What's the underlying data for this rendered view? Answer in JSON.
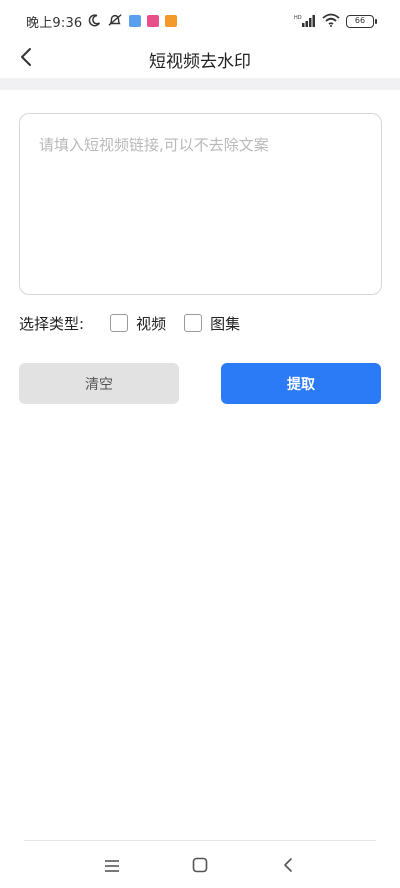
{
  "status_bar": {
    "time": "晚上9:36",
    "battery": "66",
    "network": "HD"
  },
  "header": {
    "title": "短视频去水印"
  },
  "input": {
    "placeholder": "请填入短视频链接,可以不去除文案",
    "value": ""
  },
  "type_selector": {
    "label": "选择类型:",
    "options": [
      {
        "label": "视频",
        "checked": false
      },
      {
        "label": "图集",
        "checked": false
      }
    ]
  },
  "buttons": {
    "clear_label": "清空",
    "extract_label": "提取"
  },
  "colors": {
    "primary": "#2b7bf6",
    "secondary_button": "#e2e2e2",
    "divider_band": "#f1f1f3",
    "placeholder": "#b9b9b9"
  },
  "icons": {
    "back": "chevron-left-icon",
    "nav_menu": "menu-icon",
    "nav_home": "home-icon",
    "nav_back": "back-icon"
  }
}
